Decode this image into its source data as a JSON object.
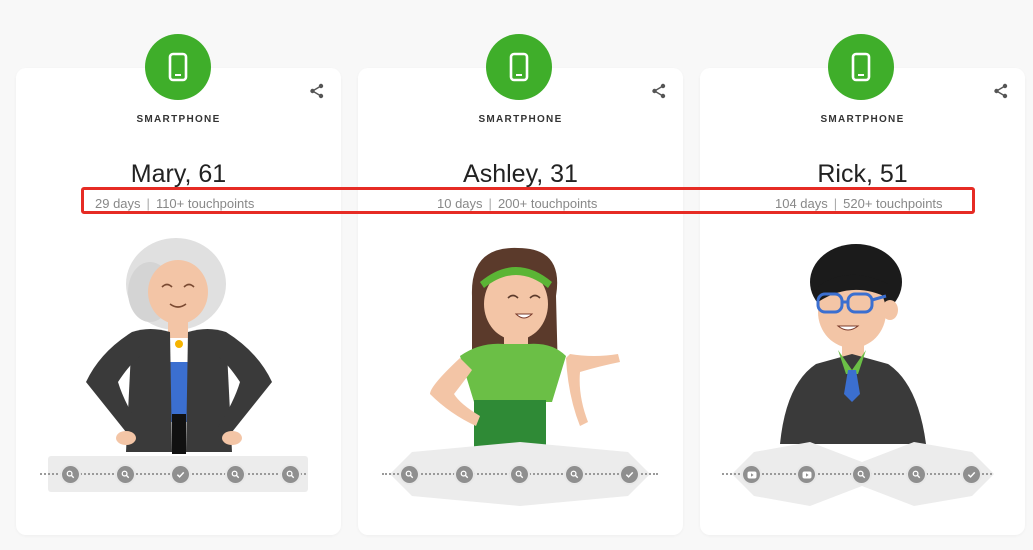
{
  "personas": [
    {
      "category": "SMARTPHONE",
      "name": "Mary, 61",
      "days": "29 days",
      "touchpoints": "110+ touchpoints",
      "journey": [
        "search-icon",
        "search-icon",
        "check-icon",
        "search-icon",
        "search-icon"
      ]
    },
    {
      "category": "SMARTPHONE",
      "name": "Ashley, 31",
      "days": "10 days",
      "touchpoints": "200+ touchpoints",
      "journey": [
        "search-icon",
        "search-icon",
        "search-icon",
        "search-icon",
        "check-icon"
      ]
    },
    {
      "category": "SMARTPHONE",
      "name": "Rick, 51",
      "days": "104 days",
      "touchpoints": "520+ touchpoints",
      "journey": [
        "video-icon",
        "video-icon",
        "search-icon",
        "search-icon",
        "check-icon"
      ]
    }
  ],
  "colors": {
    "accent_green": "#3fae2a",
    "highlight_red": "#e62b24",
    "journey_dot": "#8f8f8f"
  }
}
